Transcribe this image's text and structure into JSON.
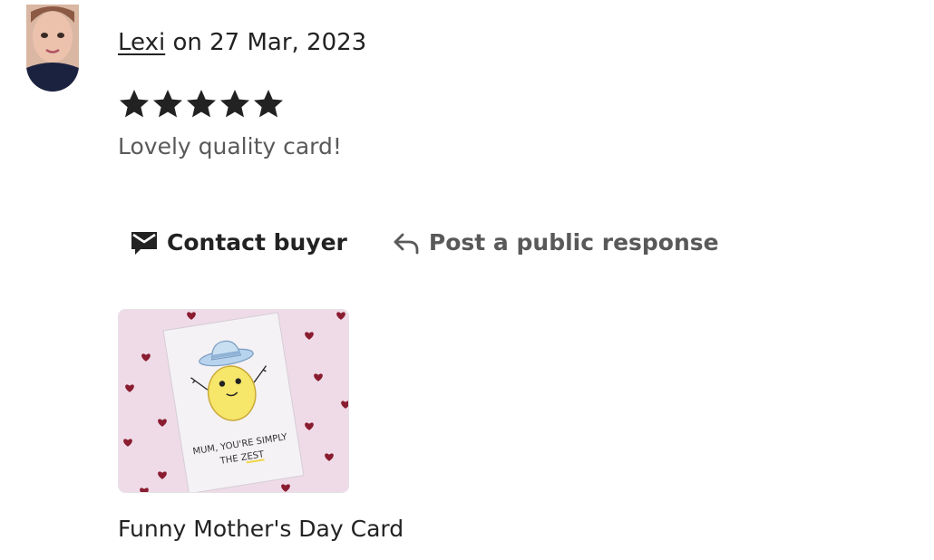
{
  "review": {
    "reviewer_name": "Lexi",
    "date_text": "on 27 Mar, 2023",
    "rating": 5,
    "rating_max": 5,
    "text": "Lovely quality card!"
  },
  "actions": {
    "contact_label": "Contact buyer",
    "respond_label": "Post a public response"
  },
  "item": {
    "title": "Funny Mother's Day Card",
    "card_text_line1": "MUM, YOU'RE SIMPLY",
    "card_text_line2": "THE ZEST"
  },
  "colors": {
    "text_primary": "#222222",
    "text_secondary": "#595959",
    "thumbnail_bg": "#efdbe8",
    "heart": "#8a1c30"
  },
  "icons": {
    "contact": "envelope-icon",
    "respond": "reply-arrow-icon",
    "star": "star-icon"
  }
}
